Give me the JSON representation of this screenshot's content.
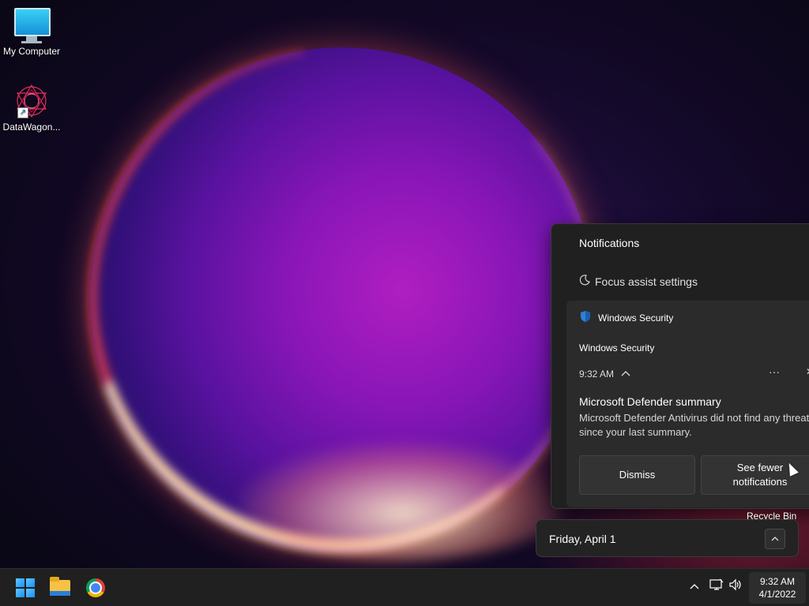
{
  "desktop": {
    "icons": [
      {
        "label": "My Computer",
        "icon": "monitor-icon"
      },
      {
        "label": "DataWagon...",
        "icon": "datawagon-icon"
      }
    ],
    "recycle_bin_label": "Recycle Bin"
  },
  "notifications": {
    "title": "Notifications",
    "focus_assist": "Focus assist settings",
    "card": {
      "app_name": "Windows Security",
      "app_icon": "shield-icon",
      "subtitle": "Windows Security",
      "time": "9:32 AM",
      "more_glyph": "···",
      "close_glyph": "✕",
      "heading": "Microsoft Defender summary",
      "body": "Microsoft Defender Antivirus did not find any threats since your last summary.",
      "dismiss_label": "Dismiss",
      "see_fewer_line1": "See fewer",
      "see_fewer_line2": "notifications"
    }
  },
  "calendar": {
    "date_label": "Friday, April 1"
  },
  "taskbar": {
    "apps": [
      {
        "name": "start",
        "icon": "windows-logo-icon"
      },
      {
        "name": "file-explorer",
        "icon": "folder-icon"
      },
      {
        "name": "chrome",
        "icon": "chrome-icon"
      }
    ],
    "clock_time": "9:32 AM",
    "clock_date": "4/1/2022",
    "accent": "#1a8fff"
  }
}
